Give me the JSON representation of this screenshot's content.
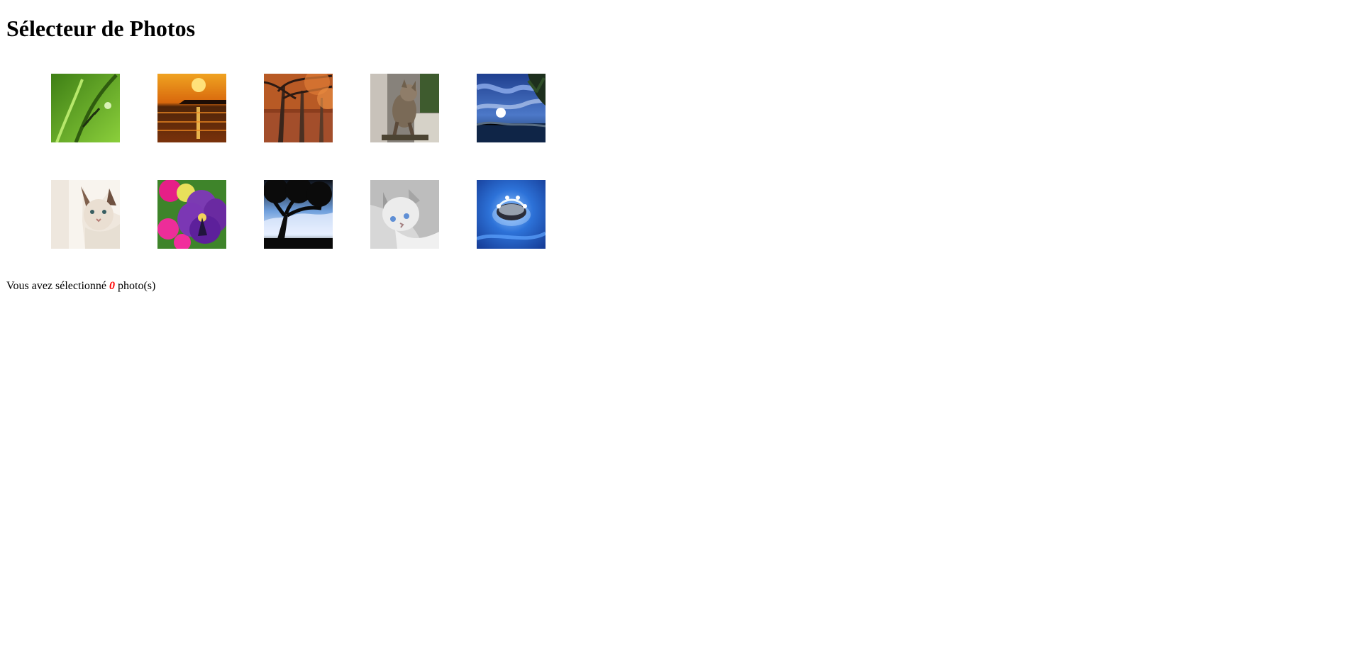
{
  "page": {
    "title": "Sélecteur de Photos"
  },
  "photos": [
    {
      "name": "grass-photo",
      "colors": [
        "#4a8f1d",
        "#8bcf3b"
      ]
    },
    {
      "name": "sunset-sea-photo",
      "colors": [
        "#f39a13",
        "#4a1e08"
      ]
    },
    {
      "name": "autumn-trees-photo",
      "colors": [
        "#6a3a1f",
        "#d56a2a"
      ]
    },
    {
      "name": "cat-walking-photo",
      "colors": [
        "#7a7470",
        "#4b4a2e"
      ]
    },
    {
      "name": "night-sky-photo",
      "colors": [
        "#1d3f8f",
        "#7fa8e8"
      ]
    },
    {
      "name": "white-cat-photo",
      "colors": [
        "#f7f2ea",
        "#d9c9b8"
      ]
    },
    {
      "name": "pansy-flower-photo",
      "colors": [
        "#6d2fa3",
        "#f0309a"
      ]
    },
    {
      "name": "tree-silhouette-photo",
      "colors": [
        "#0e1219",
        "#4f7fc4"
      ]
    },
    {
      "name": "grey-kitten-photo",
      "colors": [
        "#d8d8d8",
        "#9f9f9f"
      ]
    },
    {
      "name": "water-drop-photo",
      "colors": [
        "#2a63d4",
        "#8fb7ff"
      ]
    }
  ],
  "status": {
    "prefix": "Vous avez sélectionné",
    "count": "0",
    "suffix": "photo(s)"
  }
}
